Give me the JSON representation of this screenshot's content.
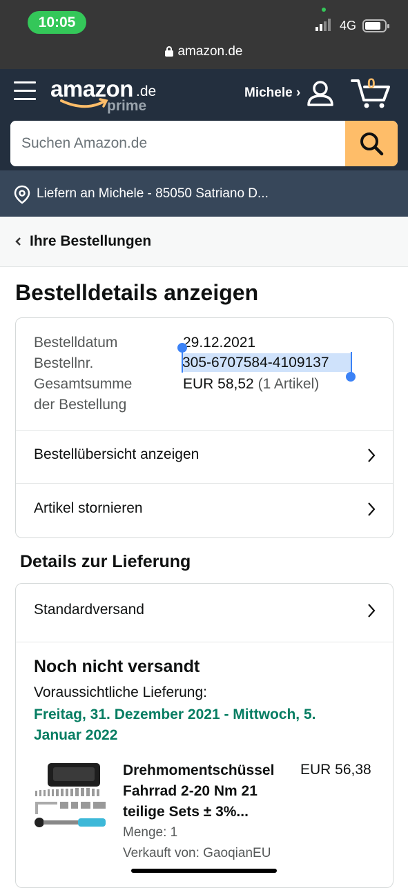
{
  "status_bar": {
    "time": "10:05",
    "network": "4G",
    "url": "amazon.de"
  },
  "header": {
    "logo": {
      "word": "amazon",
      "tld": ".de",
      "sub": "prime"
    },
    "account_label": "Michele ›",
    "cart_count": "0",
    "search_placeholder": "Suchen Amazon.de"
  },
  "delivery_bar": {
    "text": "Liefern an Michele - 85050 Satriano D..."
  },
  "breadcrumb": {
    "label": "Ihre Bestellungen"
  },
  "page_title": "Bestelldetails anzeigen",
  "order_summary": {
    "date_label": "Bestelldatum",
    "date_value": "29.12.2021",
    "number_label": "Bestellnr.",
    "number_value": "305-6707584-4109137",
    "total_label_line1": "Gesamtsumme",
    "total_label_line2": "der Bestellung",
    "total_value": "EUR 58,52",
    "total_items": "(1 Artikel)",
    "links": [
      "Bestellübersicht anzeigen",
      "Artikel stornieren"
    ]
  },
  "delivery_details": {
    "title": "Details zur Lieferung",
    "shipping_method": "Standardversand",
    "status": "Noch nicht versandt",
    "estimate_label": "Voraussichtliche Lieferung:",
    "estimate_date": "Freitag, 31. Dezember 2021 - Mittwoch, 5. Januar 2022",
    "product": {
      "title": "Drehmomentschüssel Fahrrad 2-20 Nm 21 teilige Sets ± 3%...",
      "price": "EUR 56,38",
      "quantity": "Menge: 1",
      "seller": "Verkauft von: GaoqianEU"
    }
  },
  "colors": {
    "status_bar_bg": "#373737",
    "header_bg": "#232f3e",
    "delivery_bar_bg": "#37475a",
    "search_button": "#febd69",
    "estimate_green": "#067d62",
    "selection_blue": "#3b82f6"
  },
  "icons": [
    "signal-icon",
    "battery-icon",
    "lock-icon",
    "menu-icon",
    "person-icon",
    "cart-icon",
    "search-icon",
    "location-pin-icon",
    "chevron-left-icon",
    "chevron-right-icon"
  ]
}
